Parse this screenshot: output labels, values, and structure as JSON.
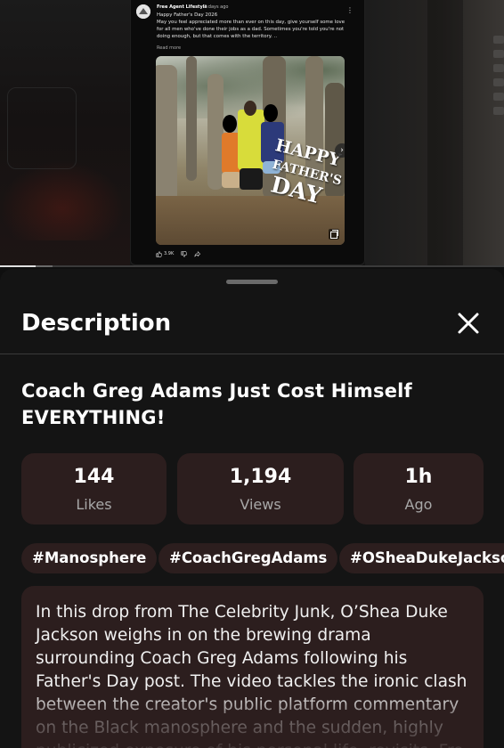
{
  "video": {
    "post": {
      "channel": "Free Agent Lifestyle",
      "time": "2 days ago",
      "text": "Happy Father's Day 2026\nMay you feel appreciated more than ever on this day, give yourself some love for all men who've done their jobs as a dad. Sometimes you're told you're not doing enough, but that comes with the territory. ..",
      "read_more": "Read more",
      "image_text_line1": "HAPPY",
      "image_text_line2": "FATHER'S",
      "image_text_line3": "DAY",
      "likes": "3.9K"
    },
    "progress": 0.07,
    "buffered": 0.105
  },
  "sheet": {
    "title": "Description",
    "close_icon": "close-icon"
  },
  "video_title": "Coach Greg Adams Just Cost Himself EVERYTHING!",
  "stats": [
    {
      "value": "144",
      "label": "Likes"
    },
    {
      "value": "1,194",
      "label": "Views"
    },
    {
      "value": "1h",
      "label": "Ago"
    }
  ],
  "tags": [
    "#Manosphere",
    "#CoachGregAdams",
    "#OSheaDukeJackson"
  ],
  "description": "In this drop from The Celebrity Junk, O’Shea Duke Jackson weighs in on the brewing drama surrounding Coach Greg Adams following his Father's Day post. The video tackles the ironic clash between the creator's public platform commentary on the Black manosphere and the sudden, highly publicized exposure of his personal life, revisits. Fro"
}
